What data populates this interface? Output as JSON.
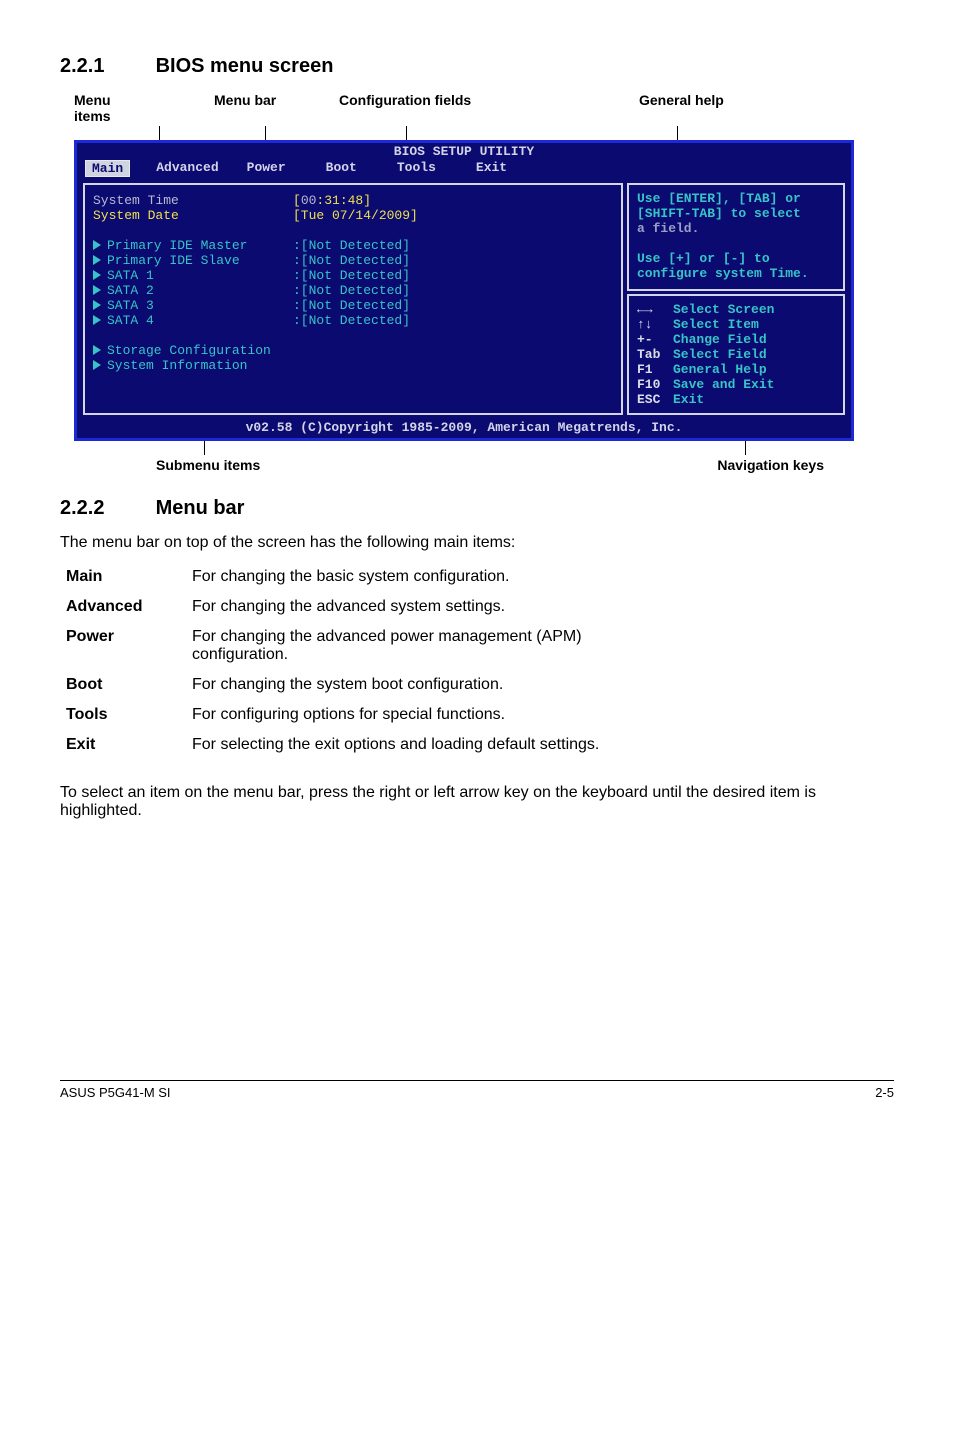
{
  "headings": {
    "s1_num": "2.2.1",
    "s1_title": "BIOS menu screen",
    "s2_num": "2.2.2",
    "s2_title": "Menu bar"
  },
  "dlabels": {
    "menu_items": "Menu items",
    "menu_bar": "Menu bar",
    "config_fields": "Configuration fields",
    "general_help": "General help",
    "submenu_items": "Submenu items",
    "nav_keys": "Navigation keys"
  },
  "bios": {
    "title": "BIOS SETUP UTILITY",
    "tabs": {
      "main": "Main",
      "advanced": "Advanced",
      "power": "Power",
      "boot": "Boot",
      "tools": "Tools",
      "exit": "Exit"
    },
    "rows": {
      "sys_time_lbl": "System Time",
      "sys_time_val_pre": "[",
      "sys_time_val_hh": "00",
      "sys_time_val_rest": ":31:48]",
      "sys_date_lbl": "System Date",
      "sys_date_val": "[Tue 07/14/2009]",
      "pide_m": "Primary IDE Master",
      "pide_m_v": ":[Not Detected]",
      "pide_s": "Primary IDE Slave",
      "pide_s_v": ":[Not Detected]",
      "sata1": "SATA 1",
      "sata1_v": ":[Not Detected]",
      "sata2": "SATA 2",
      "sata2_v": ":[Not Detected]",
      "sata3": "SATA 3",
      "sata3_v": ":[Not Detected]",
      "sata4": "SATA 4",
      "sata4_v": ":[Not Detected]",
      "storage": "Storage Configuration",
      "sysinfo": "System Information"
    },
    "help_top_1": "Use [ENTER], [TAB] or",
    "help_top_2": "[SHIFT-TAB] to select",
    "help_top_3": "a field.",
    "help_top_4": "Use [+] or [-] to",
    "help_top_5": "configure system Time.",
    "nav": {
      "k1": "←→",
      "d1": "Select Screen",
      "k2": "↑↓",
      "d2": "Select Item",
      "k3": "+-",
      "d3": "Change Field",
      "k4": "Tab",
      "d4": "Select Field",
      "k5": "F1",
      "d5": "General Help",
      "k6": "F10",
      "d6": "Save and Exit",
      "k7": "ESC",
      "d7": "Exit"
    },
    "footer": "v02.58 (C)Copyright 1985-2009, American Megatrends, Inc."
  },
  "s2_intro": "The menu bar on top of the screen has the following main items:",
  "defs": {
    "main": {
      "t": "Main",
      "d": "For changing the basic system configuration."
    },
    "advanced": {
      "t": "Advanced",
      "d": "For changing the advanced system settings."
    },
    "power": {
      "t": "Power",
      "d": "For changing the advanced power management (APM) configuration."
    },
    "boot": {
      "t": "Boot",
      "d": "For changing the system boot configuration."
    },
    "tools": {
      "t": "Tools",
      "d": "For configuring options for special functions."
    },
    "exit": {
      "t": "Exit",
      "d": "For selecting the exit options and loading default settings."
    }
  },
  "s2_outro": "To select an item on the menu bar, press the right or left arrow key on the keyboard until the desired item is highlighted.",
  "pagefoot": {
    "left": "ASUS P5G41-M SI",
    "right": "2-5"
  }
}
